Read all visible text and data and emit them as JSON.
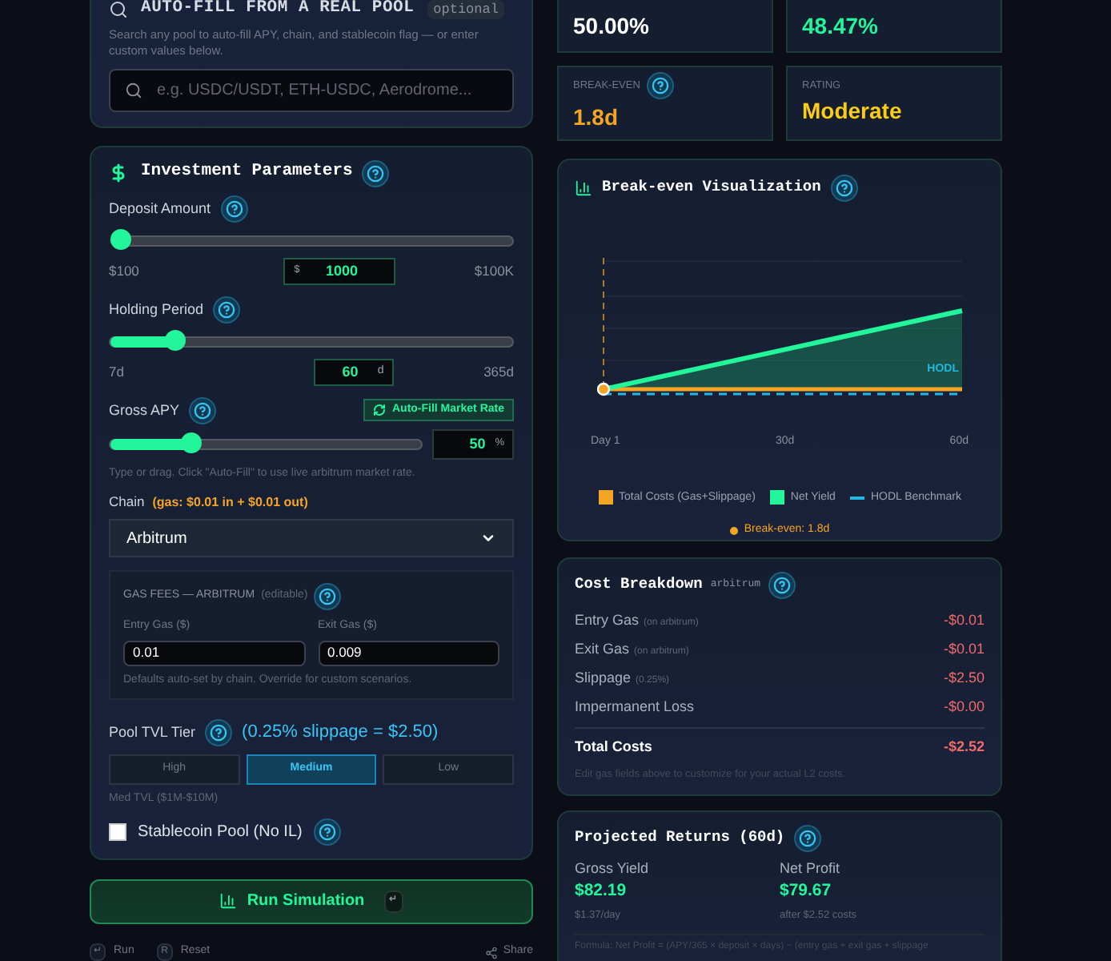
{
  "pool_search": {
    "title": "AUTO-FILL FROM A REAL POOL",
    "tag": "optional",
    "description": "Search any pool to auto-fill APY, chain, and stablecoin flag — or enter custom values below.",
    "placeholder": "e.g. USDC/USDT, ETH-USDC, Aerodrome..."
  },
  "investment": {
    "title": "Investment Parameters",
    "deposit": {
      "label": "Deposit Amount",
      "level": 0.02,
      "min": "$100",
      "max": "$100K",
      "prefix": "$",
      "value": "1000"
    },
    "holding": {
      "label": "Holding Period",
      "level": 0.16,
      "min": "7d",
      "max": "365d",
      "value": "60",
      "unit": "d"
    },
    "apy": {
      "label": "Gross APY",
      "button": "Auto-Fill Market Rate",
      "level": 0.26,
      "value": "50",
      "unit": "%",
      "hint": "Type or drag. Click \"Auto-Fill\" to use live arbitrum market rate."
    },
    "chain": {
      "label": "Chain",
      "gas_note": "(gas: $0.01 in + $0.01 out)",
      "value": "Arbitrum"
    },
    "gas_fees": {
      "title": "GAS FEES — ARBITRUM",
      "editable": "(editable)",
      "entry_label": "Entry Gas ($)",
      "entry_value": "0.01",
      "exit_label": "Exit Gas ($)",
      "exit_value": "0.009",
      "hint": "Defaults auto-set by chain. Override for custom scenarios."
    },
    "tvl": {
      "label": "Pool TVL Tier",
      "slippage": "(0.25% slippage = $2.50)",
      "options": [
        {
          "label": "High",
          "selected": false
        },
        {
          "label": "Medium",
          "selected": true
        },
        {
          "label": "Low",
          "selected": false
        }
      ],
      "hint": "Med TVL ($1M-$10M)"
    },
    "stablecoin": {
      "label": "Stablecoin Pool (No IL)",
      "checked": false
    }
  },
  "run_button": {
    "label": "Run Simulation",
    "key": "↵"
  },
  "footer": {
    "shortcuts": [
      {
        "key": "↵",
        "label": "Run"
      },
      {
        "key": "R",
        "label": "Reset"
      }
    ],
    "share": "Share"
  },
  "stats": [
    {
      "value": "50.00%",
      "color": "#ffffff"
    },
    {
      "value": "48.47%",
      "color": "#22f59a"
    },
    {
      "label": "BREAK-EVEN",
      "help": true,
      "value": "1.8d",
      "color": "#f5a524"
    },
    {
      "label": "RATING",
      "help": false,
      "value": "Moderate",
      "color": "#facc15"
    }
  ],
  "chart": {
    "title": "Break-even Visualization",
    "hodl_label": "HODL",
    "x_labels": [
      "Day 1",
      "30d",
      "60d"
    ],
    "legend": [
      {
        "kind": "square",
        "label": "Total Costs (Gas+Slippage)",
        "color": "#f5a524"
      },
      {
        "kind": "square",
        "label": "Net Yield",
        "color": "#22f59a"
      },
      {
        "kind": "dash",
        "label": "HODL Benchmark",
        "color": "#22b8e0"
      }
    ],
    "break_even": "Break-even: 1.8d"
  },
  "costs": {
    "title": "Cost Breakdown",
    "chain": "arbitrum",
    "rows": [
      {
        "label": "Entry Gas",
        "note": "(on arbitrum)",
        "value": "-$0.01"
      },
      {
        "label": "Exit Gas",
        "note": "(on arbitrum)",
        "value": "-$0.01"
      },
      {
        "label": "Slippage",
        "note": "(0.25%)",
        "value": "-$2.50"
      },
      {
        "label": "Impermanent Loss",
        "value": "-$0.00"
      }
    ],
    "total": {
      "label": "Total Costs",
      "value": "-$2.52"
    },
    "hint": "Edit gas fields above to customize for your actual L2 costs."
  },
  "returns": {
    "title": "Projected Returns (60d)",
    "items": [
      {
        "label": "Gross Yield",
        "value": "$82.19",
        "sub": "$1.37/day"
      },
      {
        "label": "Net Profit",
        "value": "$79.67",
        "sub": "after $2.52 costs"
      }
    ],
    "formula": "Formula: Net Profit = (APY/365 × deposit × days) − (entry gas + exit gas + slippage"
  }
}
